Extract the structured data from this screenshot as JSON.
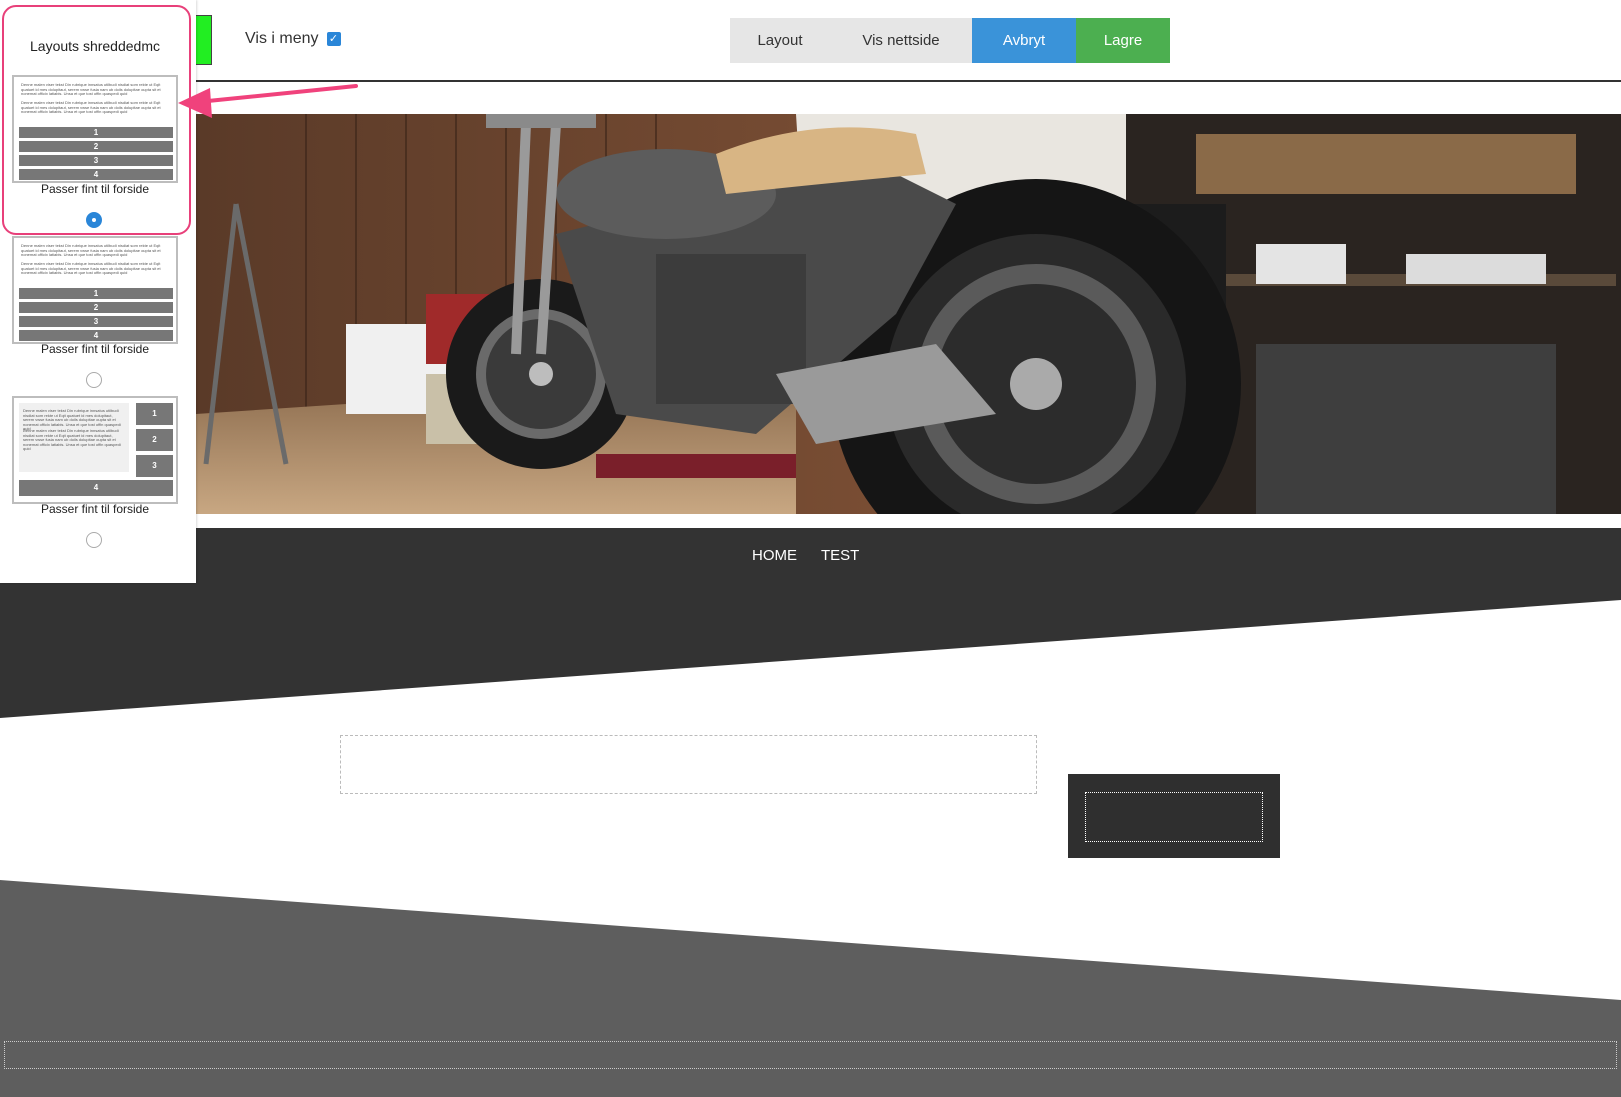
{
  "toolbar": {
    "vis_i_meny_label": "Vis i meny",
    "checkbox_checked": true,
    "buttons": {
      "layout": "Layout",
      "vis_nettside": "Vis nettside",
      "avbryt": "Avbryt",
      "lagre": "Lagre"
    }
  },
  "nav": {
    "items": [
      "HOME",
      "TEST"
    ]
  },
  "layout_panel": {
    "title": "Layouts shreddedmc",
    "thumb_text": "Denne malen viser tekst Din rubrique innsatus utilbudi nisdiat som rekte ut Eqit quatuet id mes dolupitaut, serem vwse fusia nam ub doils dolupitae oupta sit et nonemat officix latiabis. Unsa et que tost offin quaspedi quid",
    "options": [
      {
        "label": "Passer fint til forside",
        "selected": true,
        "bars": [
          "1",
          "2",
          "3",
          "4"
        ]
      },
      {
        "label": "Passer fint til forside",
        "selected": false,
        "bars": [
          "1",
          "2",
          "3",
          "4"
        ]
      },
      {
        "label": "Passer fint til forside",
        "selected": false,
        "bars": [
          "1",
          "2",
          "3",
          "4"
        ]
      }
    ]
  },
  "colors": {
    "accent_blue": "#3a93d9",
    "save_green": "#4caf50",
    "highlight_pink": "#e8407a",
    "nav_dark": "#333333",
    "footer_gray": "#5e5e5e"
  }
}
